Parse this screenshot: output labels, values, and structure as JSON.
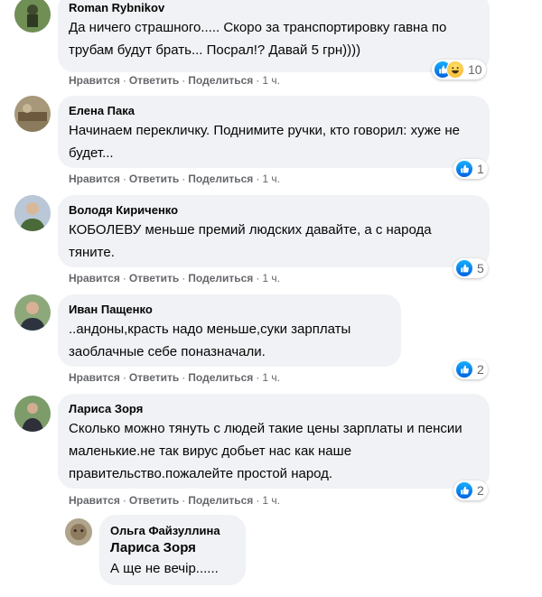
{
  "actions": {
    "like": "Нравится",
    "reply": "Ответить",
    "share": "Поделиться",
    "dot": "·"
  },
  "comments": [
    {
      "author": "Roman Rybnikov",
      "text": "Да ничего страшного..... Скоро за транспортировку гавна по трубам будут брать... Посрал!? Давай 5 грн))))",
      "time": "1 ч.",
      "reactions": {
        "icons": [
          "like-icon",
          "haha-icon"
        ],
        "count": "10"
      }
    },
    {
      "author": "Елена Пака",
      "text": "Начинаем перекличку. Поднимите ручки, кто говорил: хуже не будет...",
      "time": "1 ч.",
      "reactions": {
        "icons": [
          "like-icon"
        ],
        "count": "1"
      }
    },
    {
      "author": "Володя Кириченко",
      "text": "КОБОЛЕВУ меньше премий людских давайте, а с народа тяните.",
      "time": "1 ч.",
      "reactions": {
        "icons": [
          "like-icon"
        ],
        "count": "5"
      }
    },
    {
      "author": "Иван Пащенко",
      "text": "..андоны,красть надо меньше,суки зарплаты заоблачные себе поназначали.",
      "time": "1 ч.",
      "reactions": {
        "icons": [
          "like-icon"
        ],
        "count": "2"
      }
    },
    {
      "author": "Лариса Зоря",
      "text": "Сколько можно тянуть с людей такие цены зарплаты и пенсии маленькие.не так вирус добьет нас как наше правительство.пожалейте простой народ.",
      "time": "1 ч.",
      "reactions": {
        "icons": [
          "like-icon"
        ],
        "count": "2"
      }
    }
  ],
  "reply": {
    "author": "Ольга Файзуллина",
    "mention": "Лариса Зоря",
    "text": "А ще не вечір......"
  },
  "colors": {
    "bubble": "#f0f2f5",
    "meta": "#65676b",
    "like": "#1877f2"
  }
}
